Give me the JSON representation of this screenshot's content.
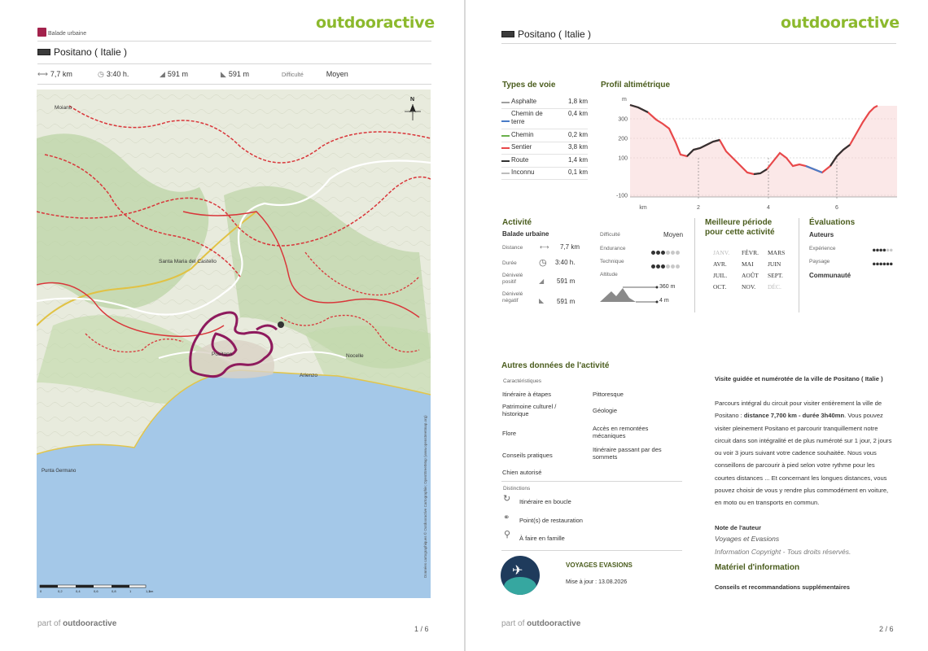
{
  "brand": "outdooractive",
  "footer": {
    "part_of": "part of",
    "brand": "outdooractive"
  },
  "page1": {
    "category": "Balade urbaine",
    "title": "Positano ( Italie )",
    "stats": {
      "distance": "7,7 km",
      "duration": "3:40 h.",
      "ascent": "591 m",
      "descent": "591 m",
      "difficulty_label": "Difficulté",
      "difficulty": "Moyen"
    },
    "map_labels": {
      "moiano": "Moiano",
      "santa_maria": "Santa Maria del Castello",
      "positano": "Positano",
      "arienzo": "Arienzo",
      "nocelle": "Nocelle",
      "punta": "Punta Germano",
      "scale": [
        "0",
        "0,2",
        "0,4",
        "0,6",
        "0,8",
        "1",
        "1,2",
        "km"
      ],
      "copyright": "Données cartographiques © Outdooractive Cartographie; OpenStreetMap (www.openstreetmap.org)"
    },
    "page_number": "1 / 6"
  },
  "page2": {
    "title": "Positano ( Italie )",
    "waytypes": {
      "title": "Types de voie",
      "rows": [
        {
          "name": "Asphalte",
          "value": "1,8 km",
          "color": "#9e9e9e"
        },
        {
          "name": "Chemin de terre",
          "value": "0,4 km",
          "color": "#4a7cc7"
        },
        {
          "name": "Chemin",
          "value": "0,2 km",
          "color": "#6ab04c"
        },
        {
          "name": "Sentier",
          "value": "3,8 km",
          "color": "#e8484a"
        },
        {
          "name": "Route",
          "value": "1,4 km",
          "color": "#333333"
        },
        {
          "name": "Inconnu",
          "value": "0,1 km",
          "color": "#bdbdbd"
        }
      ]
    },
    "profile": {
      "title": "Profil altimétrique",
      "y_unit": "m",
      "y_ticks": [
        "300",
        "200",
        "100",
        "-100"
      ],
      "x_unit": "km",
      "x_ticks": [
        "2",
        "4",
        "6"
      ]
    },
    "activity": {
      "title": "Activité",
      "type": "Balade urbaine",
      "distance_label": "Distance",
      "distance": "7,7 km",
      "duration_label": "Durée",
      "duration": "3:40 h.",
      "ascent_label": "Dénivelé positif",
      "ascent": "591 m",
      "descent_label": "Dénivelé négatif",
      "descent": "591 m",
      "difficulty_label": "Difficulté",
      "difficulty": "Moyen",
      "endurance_label": "Endurance",
      "endurance_level": 3,
      "technique_label": "Technique",
      "technique_level": 3,
      "altitude_label": "Altitude",
      "alt_max": "360 m",
      "alt_min": "4 m"
    },
    "season": {
      "title_line1": "Meilleure période",
      "title_line2": "pour cette activité",
      "months": [
        {
          "name": "JANV.",
          "active": false
        },
        {
          "name": "FÉVR.",
          "active": true
        },
        {
          "name": "MARS",
          "active": true
        },
        {
          "name": "AVR.",
          "active": true
        },
        {
          "name": "MAI",
          "active": true
        },
        {
          "name": "JUIN",
          "active": true
        },
        {
          "name": "JUIL.",
          "active": true
        },
        {
          "name": "AOÛT",
          "active": true
        },
        {
          "name": "SEPT.",
          "active": true
        },
        {
          "name": "OCT.",
          "active": true
        },
        {
          "name": "NOV.",
          "active": true
        },
        {
          "name": "DÉC.",
          "active": false
        }
      ]
    },
    "ratings": {
      "title": "Évaluations",
      "authors": "Auteurs",
      "experience_label": "Expérience",
      "experience_level": 4,
      "landscape_label": "Paysage",
      "landscape_level": 6,
      "community": "Communauté"
    },
    "other": {
      "title": "Autres données de l'activité",
      "characteristics_label": "Caractéristiques",
      "left": [
        "Itinéraire à étapes",
        "Patrimoine culturel / historique",
        "Flore",
        "Conseils pratiques",
        "Chien autorisé"
      ],
      "right": [
        "Pittoresque",
        "Géologie",
        "Accès en remontées mécaniques",
        "Itinéraire passant par des sommets"
      ],
      "distinctions_label": "Distinctions",
      "distinctions": [
        "Itinéraire en boucle",
        "Point(s) de restauration",
        "À faire en famille"
      ]
    },
    "author_box": {
      "name": "VOYAGES EVASIONS",
      "updated": "Mise à jour : 13.08.2026"
    },
    "description": {
      "heading": "Visite guidée et numérotée de la ville de Positano ( Italie )",
      "intro_a": "Parcours intégral du circuit pour visiter entièrement la ville de Positano : ",
      "intro_b": "distance 7,700 km - durée 3h40mn",
      "body": ". Vous pouvez visiter pleinement Positano et parcourir tranquillement notre circuit dans son intégralité et de plus numéroté sur 1 jour, 2 jours ou voir 3 jours suivant votre cadence souhaitée. Nous vous conseillons de parcourir à pied selon votre rythme pour les courtes distances ... Et concernant les longues distances, vous pouvez choisir de vous y rendre plus commodément en voiture, en moto ou en transports en commun.",
      "author_note_label": "Note de l'auteur",
      "author_note": "Voyages et Evasions",
      "copyright": "Information Copyright - Tous droits réservés.",
      "material_title": "Matériel d'information",
      "material_text": "Conseils et recommandations supplémentaires"
    },
    "page_number": "2 / 6"
  }
}
